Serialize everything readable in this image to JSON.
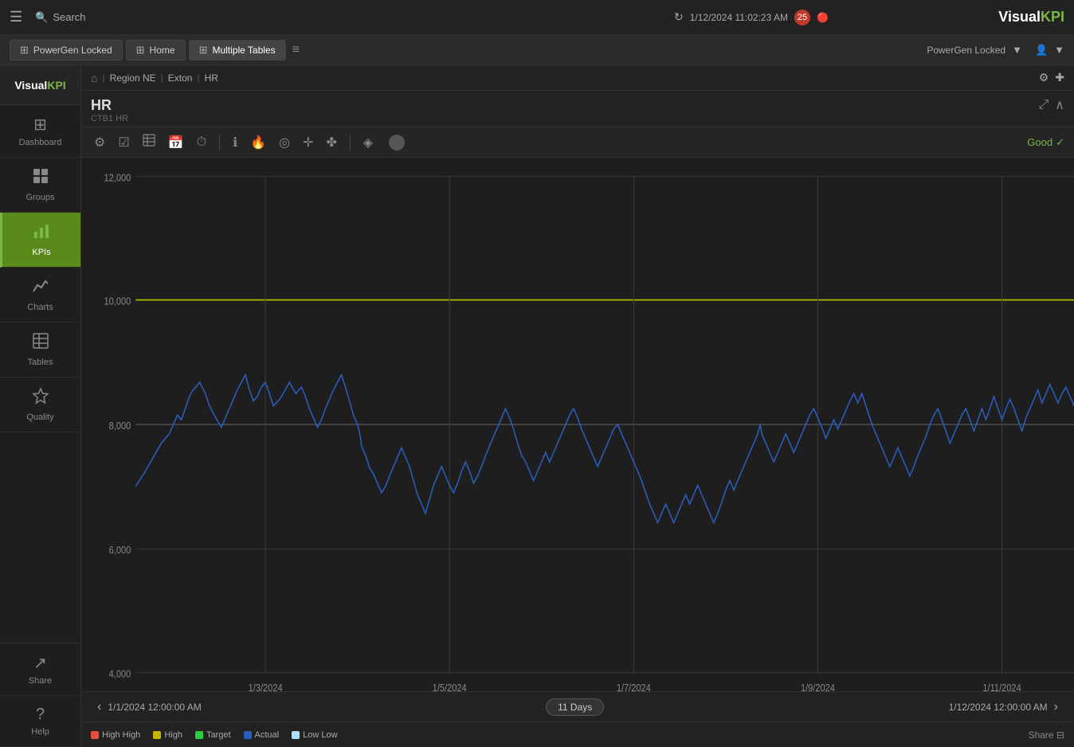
{
  "topbar": {
    "menu_icon": "☰",
    "search_placeholder": "Search",
    "refresh_icon": "↻",
    "datetime": "1/12/2024 11:02:23 AM",
    "notification_count": "25",
    "logo_visual": "Visual",
    "logo_kpi": "KPI"
  },
  "tabs": {
    "items": [
      {
        "id": "powergen-locked",
        "label": "PowerGen Locked",
        "icon": "⊞",
        "active": false
      },
      {
        "id": "home",
        "label": "Home",
        "icon": "⊞",
        "active": false
      },
      {
        "id": "multiple-tables",
        "label": "Multiple Tables",
        "icon": "⊞",
        "active": true
      }
    ],
    "menu_icon": "≡",
    "user_label": "PowerGen Locked",
    "user_icon": "👤"
  },
  "sidebar": {
    "logo_visual": "Visual",
    "logo_kpi": "KPI",
    "items": [
      {
        "id": "dashboard",
        "label": "Dashboard",
        "icon": "⊞",
        "active": false
      },
      {
        "id": "groups",
        "label": "Groups",
        "icon": "⊞",
        "active": false
      },
      {
        "id": "kpis",
        "label": "KPIs",
        "icon": "📊",
        "active": true
      },
      {
        "id": "charts",
        "label": "Charts",
        "icon": "📈",
        "active": false
      },
      {
        "id": "tables",
        "label": "Tables",
        "icon": "⊞",
        "active": false
      },
      {
        "id": "quality",
        "label": "Quality",
        "icon": "⊞",
        "active": false
      },
      {
        "id": "share",
        "label": "Share",
        "icon": "↗",
        "active": false
      },
      {
        "id": "help",
        "label": "Help",
        "icon": "?",
        "active": false
      }
    ]
  },
  "breadcrumb": {
    "home_icon": "⌂",
    "items": [
      "Region NE",
      "Exton",
      "HR"
    ]
  },
  "kpi": {
    "title": "HR",
    "subtitle": "CTB1 HR"
  },
  "toolbar": {
    "buttons": [
      "⚙",
      "☑",
      "⊟",
      "📅",
      "⏱",
      "ℹ",
      "🔥",
      "📐",
      "⊕",
      "✚",
      "⊕",
      "◈"
    ],
    "dot_color": "#666",
    "status_label": "Good",
    "status_check": "✓"
  },
  "chart": {
    "y_labels": [
      "12,000",
      "10,000",
      "8,000",
      "6,000",
      "4,000"
    ],
    "x_labels": [
      "1/3/2024",
      "1/5/2024",
      "1/7/2024",
      "1/9/2024",
      "1/11/2024"
    ],
    "target_value": 10000,
    "mean_value": 8000,
    "y_min": 4000,
    "y_max": 12000
  },
  "chart_nav": {
    "prev_icon": "‹",
    "next_icon": "›",
    "start_date": "1/1/2024 12:00:00 AM",
    "end_date": "1/12/2024 12:00:00 AM",
    "period": "11 Days"
  },
  "legend": {
    "items": [
      {
        "label": "High High",
        "color": "#e74c3c"
      },
      {
        "label": "High",
        "color": "#c8b400"
      },
      {
        "label": "Target",
        "color": "#2ecc40"
      },
      {
        "label": "Actual",
        "color": "#2a5dbd"
      },
      {
        "label": "Low Low",
        "color": "#aaddff"
      }
    ],
    "share_label": "Share ⊟"
  }
}
